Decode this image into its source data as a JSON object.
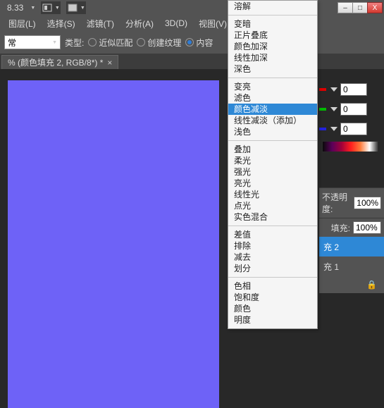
{
  "toolbar": {
    "zoom": "8.33",
    "zoom_arrow": "▼"
  },
  "menubar": {
    "layer": "图层(L)",
    "select": "选择(S)",
    "filter": "滤镜(T)",
    "analysis": "分析(A)",
    "threeD": "3D(D)",
    "view": "视图(V)"
  },
  "options": {
    "normal": "常",
    "type_label": "类型:",
    "approx_match": "近似匹配",
    "create_texture": "创建纹理",
    "content_aware": "内容"
  },
  "doc_tab": {
    "title": "% (颜色填充 2, RGB/8*) *",
    "close": "×"
  },
  "rgb": {
    "r": "0",
    "g": "0",
    "b": "0"
  },
  "layers": {
    "opacity_label": "不透明度:",
    "fill_label": "填充:",
    "opacity_value": "100%",
    "fill_value": "100%",
    "layer_fill2": "充 2",
    "layer_fill1": "充 1",
    "lock": "🔒"
  },
  "winbtns": {
    "min": "–",
    "max": "□",
    "close": "X"
  },
  "blend_modes": {
    "group1": [
      "溶解"
    ],
    "group2": [
      "变暗",
      "正片叠底",
      "颜色加深",
      "线性加深",
      "深色"
    ],
    "group3": [
      "变亮",
      "滤色",
      "颜色减淡",
      "线性减淡（添加）",
      "浅色"
    ],
    "group4": [
      "叠加",
      "柔光",
      "强光",
      "亮光",
      "线性光",
      "点光",
      "实色混合"
    ],
    "group5": [
      "差值",
      "排除",
      "减去",
      "划分"
    ],
    "group6": [
      "色相",
      "饱和度",
      "颜色",
      "明度"
    ],
    "selected": "颜色减淡"
  }
}
